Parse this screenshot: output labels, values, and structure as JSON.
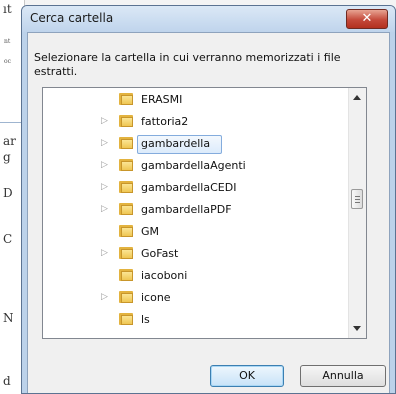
{
  "background": {
    "fragments": [
      "ıt",
      "nt",
      "oc",
      "ar",
      "g",
      "D",
      "C",
      "N",
      "d"
    ]
  },
  "dialog": {
    "title": "Cerca cartella",
    "close_label": "✕",
    "instruction": "Selezionare la cartella in cui verranno memorizzati i file estratti.",
    "folders": [
      {
        "label": "ERASMI",
        "expandable": false
      },
      {
        "label": "fattoria2",
        "expandable": true
      },
      {
        "label": "gambardella",
        "expandable": true,
        "selected": true
      },
      {
        "label": "gambardellaAgenti",
        "expandable": true
      },
      {
        "label": "gambardellaCEDI",
        "expandable": true
      },
      {
        "label": "gambardellaPDF",
        "expandable": true
      },
      {
        "label": "GM",
        "expandable": false
      },
      {
        "label": "GoFast",
        "expandable": true
      },
      {
        "label": "iacoboni",
        "expandable": false
      },
      {
        "label": "icone",
        "expandable": true
      },
      {
        "label": "ls",
        "expandable": false
      }
    ],
    "buttons": {
      "ok": "OK",
      "cancel": "Annulla"
    }
  },
  "colors": {
    "titlebar": "#c9dcf0",
    "close_button": "#c4493a",
    "selection": "#dcebfb",
    "folder": "#efc653"
  },
  "icons": {
    "folder": "folder-icon",
    "expander": "expander-arrow-icon"
  }
}
